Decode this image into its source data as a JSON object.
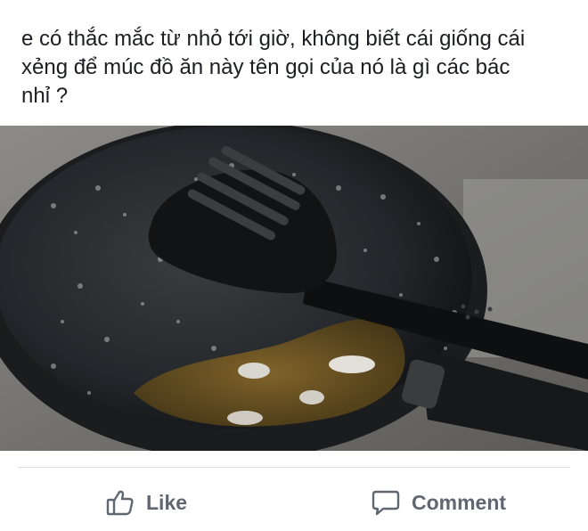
{
  "post": {
    "text": "e có thắc mắc từ nhỏ tới giờ, không biết cái giống cái\nxẻng để múc đồ ăn này tên gọi của nó là gì các bác\nnhỉ ?"
  },
  "actions": {
    "like_label": "Like",
    "like_icon": "thumbs-up-icon",
    "comment_label": "Comment",
    "comment_icon": "speech-bubble-icon"
  },
  "colors": {
    "text": "#1c1e21",
    "action_text": "#606770",
    "divider": "#dadde1"
  }
}
